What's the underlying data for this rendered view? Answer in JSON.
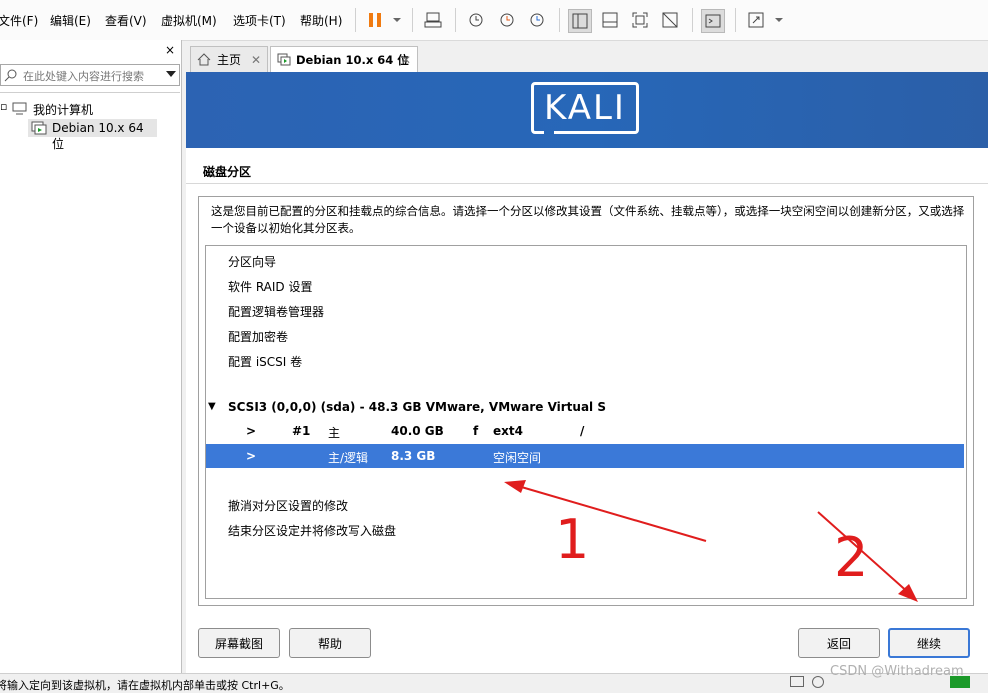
{
  "menu": {
    "file": "文件(F)",
    "edit": "编辑(E)",
    "view": "查看(V)",
    "vm": "虚拟机(M)",
    "tabs": "选项卡(T)",
    "help": "帮助(H)"
  },
  "library": {
    "close": "×",
    "search_placeholder": "在此处键入内容进行搜索",
    "tree_root": "我的计算机",
    "tree_vm": "Debian 10.x 64 位"
  },
  "tabs": [
    {
      "label": "主页",
      "icon": "home-icon"
    },
    {
      "label": "Debian 10.x 64 位",
      "icon": "vm-icon"
    }
  ],
  "vm": {
    "logo": "KALI",
    "title": "磁盘分区",
    "description": "这是您目前已配置的分区和挂载点的综合信息。请选择一个分区以修改其设置（文件系统、挂载点等），或选择一块空闲空间以创建新分区，又或选择一个设备以初始化其分区表。",
    "menu_items": [
      "分区向导",
      "软件 RAID 设置",
      "配置逻辑卷管理器",
      "配置加密卷",
      "配置 iSCSI 卷"
    ],
    "disk": "SCSI3 (0,0,0) (sda) - 48.3 GB VMware, VMware Virtual S",
    "partitions": [
      {
        "arrow": ">",
        "num": "#1",
        "type": "主",
        "size": "40.0 GB",
        "flag": "f",
        "fs": "ext4",
        "mount": "/"
      },
      {
        "arrow": ">",
        "num": "",
        "type": "主/逻辑",
        "size": "8.3 GB",
        "flag": "",
        "fs": "空闲空间",
        "mount": ""
      }
    ],
    "undo": "撤消对分区设置的修改",
    "finish": "结束分区设定并将修改写入磁盘",
    "buttons": {
      "screenshot": "屏幕截图",
      "help": "帮助",
      "back": "返回",
      "continue": "继续"
    }
  },
  "statusbar": {
    "text": "将输入定向到该虚拟机，请在虚拟机内部单击或按 Ctrl+G。"
  },
  "annotations": {
    "one": "1",
    "two": "2",
    "color": "#e01d1d"
  },
  "watermark": "CSDN @Withadream"
}
